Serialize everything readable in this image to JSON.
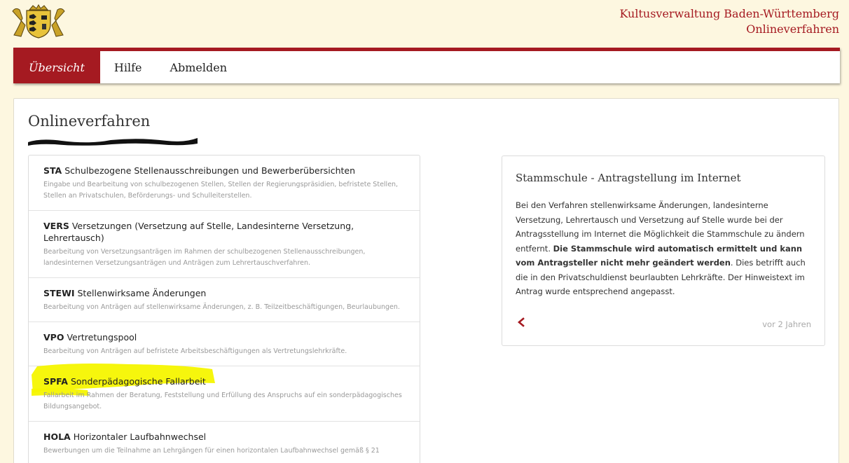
{
  "header": {
    "brand_line1": "Kultusverwaltung Baden-Württemberg",
    "brand_line2": "Onlineverfahren"
  },
  "nav": {
    "items": [
      {
        "label": "Übersicht",
        "active": true
      },
      {
        "label": "Hilfe",
        "active": false
      },
      {
        "label": "Abmelden",
        "active": false
      }
    ]
  },
  "main": {
    "title": "Onlineverfahren",
    "procedures": [
      {
        "code": "STA",
        "name": "Schulbezogene Stellenausschreibungen und Bewerberübersichten",
        "desc": "Eingabe und Bearbeitung von schulbezogenen Stellen, Stellen der Regierungspräsidien, befristete Stellen, Stellen an Privatschulen, Beförderungs- und Schulleiterstellen."
      },
      {
        "code": "VERS",
        "name": "Versetzungen (Versetzung auf Stelle, Landesinterne Versetzung, Lehrertausch)",
        "desc": "Bearbeitung von Versetzungsanträgen im Rahmen der schulbezogenen Stellenausschreibungen, landesinternen Versetzungsanträgen und Anträgen zum Lehrertauschverfahren."
      },
      {
        "code": "STEWI",
        "name": "Stellenwirksame Änderungen",
        "desc": "Bearbeitung von Anträgen auf stellenwirksame Änderungen, z. B. Teilzeitbeschäftigungen, Beurlaubungen."
      },
      {
        "code": "VPO",
        "name": "Vertretungspool",
        "desc": "Bearbeitung von Anträgen auf befristete Arbeitsbeschäftigungen als Vertretungslehrkräfte."
      },
      {
        "code": "SPFA",
        "name": "Sonderpädagogische Fallarbeit",
        "desc": "Fallarbeit im Rahmen der Beratung, Feststellung und Erfüllung des Anspruchs auf ein sonderpädagogisches Bildungsangebot."
      },
      {
        "code": "HOLA",
        "name": "Horizontaler Laufbahnwechsel",
        "desc": "Bewerbungen um die Teilnahme an Lehrgängen für einen horizontalen Laufbahnwechsel gemäß § 21"
      }
    ]
  },
  "news": {
    "title": "Stammschule - Antragstellung im Internet",
    "body_part1": "Bei den Verfahren stellenwirksame Änderungen, landesinterne Versetzung, Lehrertausch und Versetzung auf Stelle wurde bei der Antragsstellung im Internet die Möglichkeit die Stammschule zu ändern entfernt. ",
    "body_bold": "Die Stammschule wird automatisch ermittelt und kann vom Antragsteller nicht mehr geändert werden",
    "body_part2": ". Dies betrifft auch die in den Privatschuldienst beurlaubten Lehrkräfte. Der Hinweistext im Antrag wurde entsprechend angepasst.",
    "time": "vor 2 Jahren"
  },
  "colors": {
    "accent": "#a51a21",
    "highlight": "#f5f500",
    "background": "#fdf7e0"
  }
}
